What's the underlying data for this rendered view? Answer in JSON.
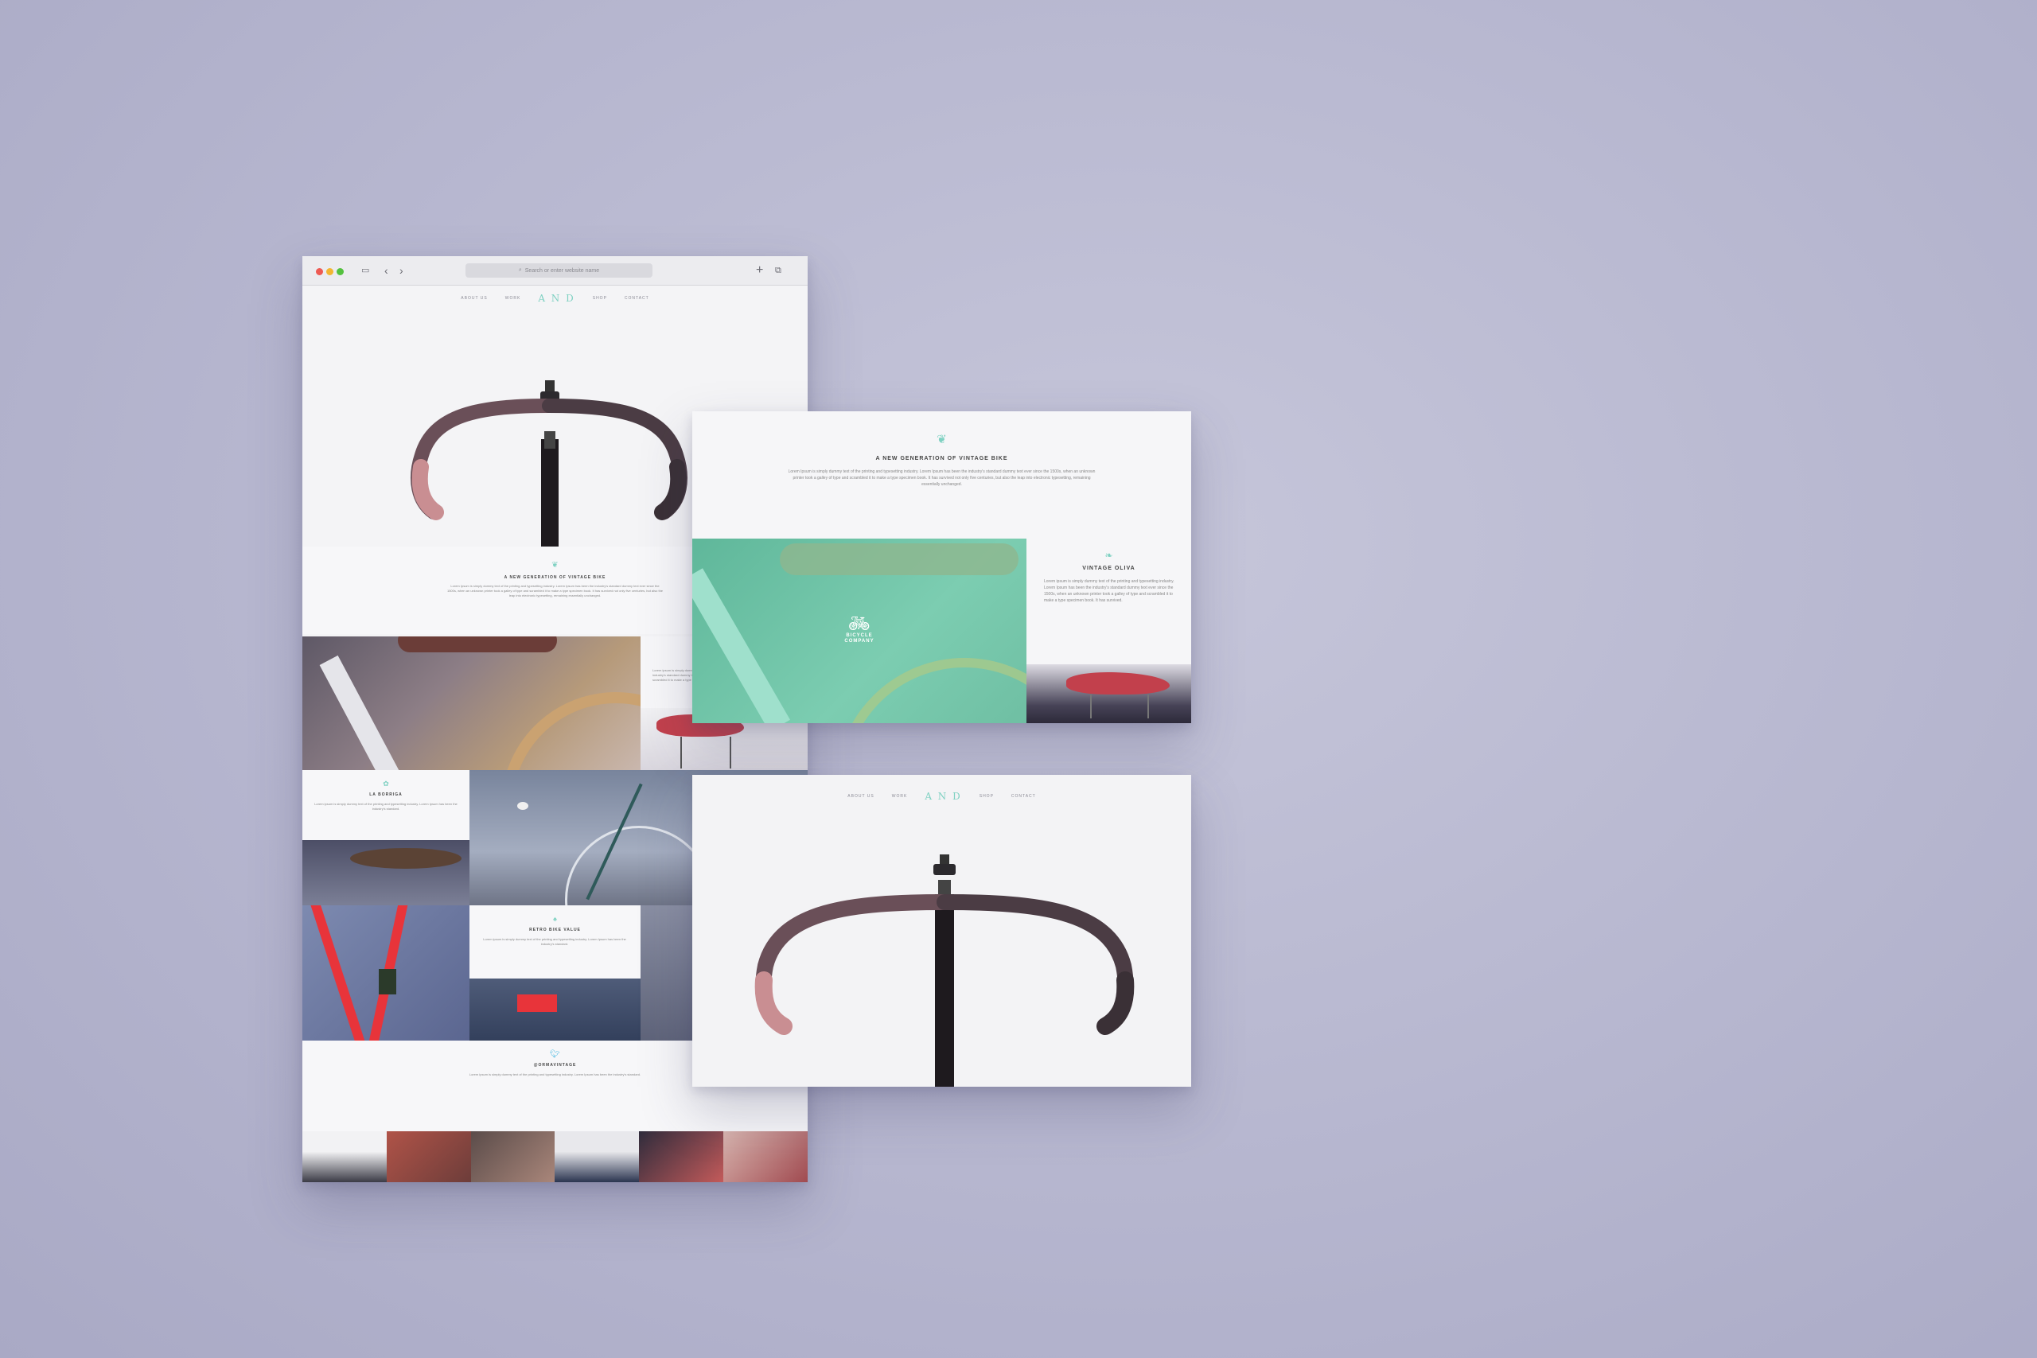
{
  "browser": {
    "url_placeholder": "Search or enter website name"
  },
  "site": {
    "nav_left": [
      "ABOUT US",
      "WORK"
    ],
    "nav_right": [
      "SHOP",
      "CONTACT"
    ],
    "logo": "A N D",
    "intro_title": "A NEW GENERATION OF VINTAGE BIKE",
    "intro_text": "Lorem Ipsum is simply dummy text of the printing and typesetting industry. Lorem Ipsum has been the industry's standard dummy text ever since the 1500s, when an unknown printer took a galley of type and scrambled it to make a type specimen book. It has survived not only five centuries, but also the leap into electronic typesetting, remaining essentially unchanged.",
    "feature_title": "VINTAGE OLIVA",
    "feature_text": "Lorem ipsum is simply dummy text of the printing and typesetting industry. Lorem Ipsum has been the industry's standard dummy text ever since the 1500s, when an unknown printer took a galley of type and scrambled it to make a type specimen book. It has survived.",
    "badge_text": "BICYCLE COMPANY",
    "section_a_title": "LA BORRIGA",
    "section_b_title": "RETRO BIKE VALUE",
    "twitter_handle": "@ORMAVINTAGE",
    "tweet_text": "Lorem ipsum is simply dummy text of the printing and typesetting industry. Lorem Ipsum has been the industry's standard.",
    "colors": {
      "accent": "#7fd1c2",
      "teal_overlay": "#6ec9a9",
      "saddle_red": "#c2404c",
      "frame_red": "#e8343a",
      "background": "#b9b9d2"
    }
  }
}
